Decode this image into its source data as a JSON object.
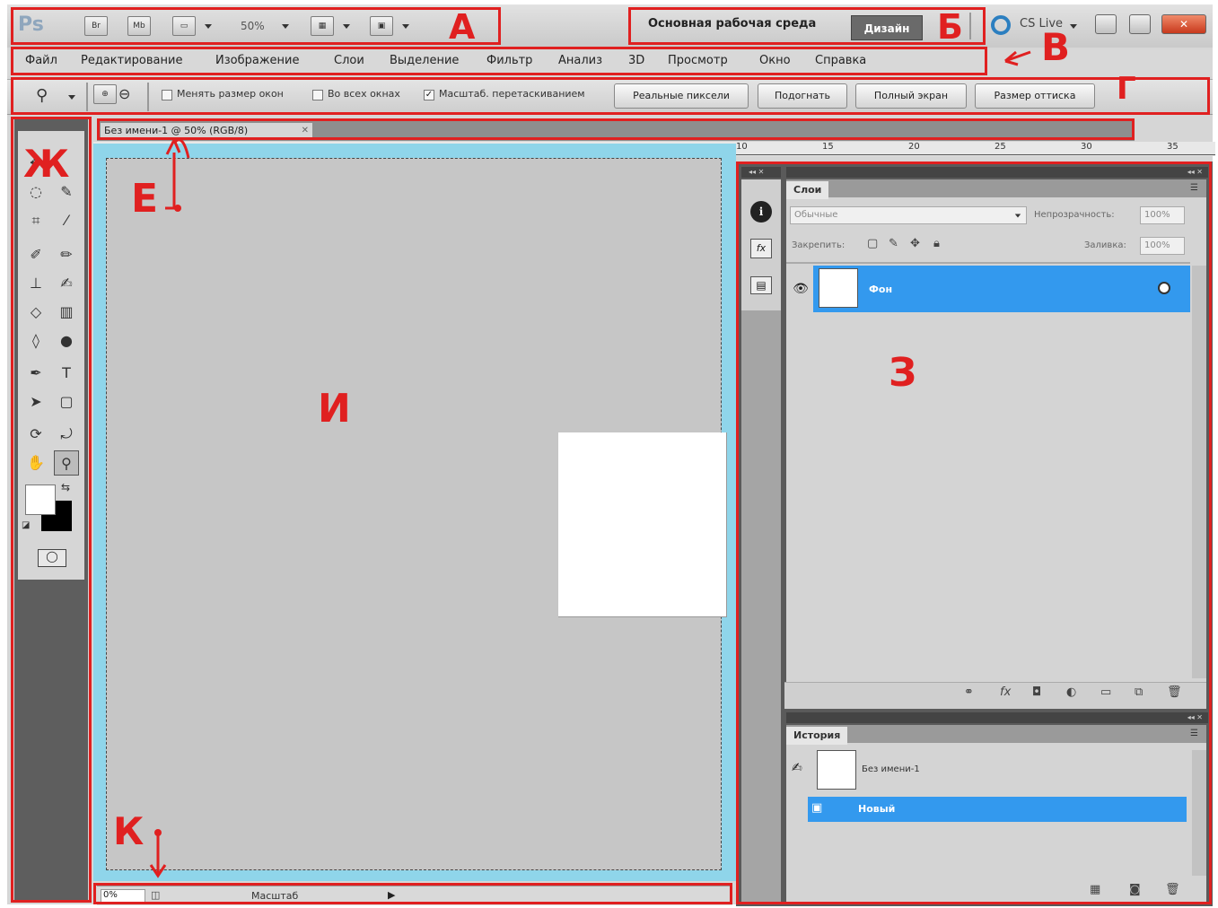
{
  "app": {
    "logo": "Ps",
    "toolbar_buttons": [
      "Br",
      "Mb"
    ],
    "zoom": "50%",
    "workspace_label": "Основная рабочая среда",
    "design_button": "Дизайн",
    "cs_live": "CS Live"
  },
  "menu": [
    "Файл",
    "Редактирование",
    "Изображение",
    "Слои",
    "Выделение",
    "Фильтр",
    "Анализ",
    "3D",
    "Просмотр",
    "Окно",
    "Справка"
  ],
  "options": {
    "resize_windows": "Менять размер окон",
    "all_windows": "Во всех окнах",
    "scrubby_zoom": "Масштаб. перетаскиванием",
    "actual_pixels": "Реальные пиксели",
    "fit_screen": "Подогнать",
    "fill_screen": "Полный экран",
    "print_size": "Размер оттиска"
  },
  "document": {
    "tab_title": "Без имени-1 @ 50% (RGB/8)",
    "ruler_ticks": [
      "10",
      "15",
      "20",
      "25",
      "30",
      "35"
    ]
  },
  "status": {
    "zoom": "0%",
    "mode": "Масштаб"
  },
  "layers_panel": {
    "tab": "Слои",
    "blend_mode": "Обычные",
    "opacity_label": "Непрозрачность:",
    "opacity_value": "100%",
    "lock_label": "Закрепить:",
    "fill_label": "Заливка:",
    "fill_value": "100%",
    "layer_name": "Фон"
  },
  "history_panel": {
    "tab": "История",
    "snapshot_name": "Без имени-1",
    "state_name": "Новый"
  },
  "annotations": {
    "A": "А",
    "B": "Б",
    "V": "В",
    "G": "Г",
    "E": "Е",
    "ZH": "Ж",
    "Z": "З",
    "I": "И",
    "K": "К"
  }
}
